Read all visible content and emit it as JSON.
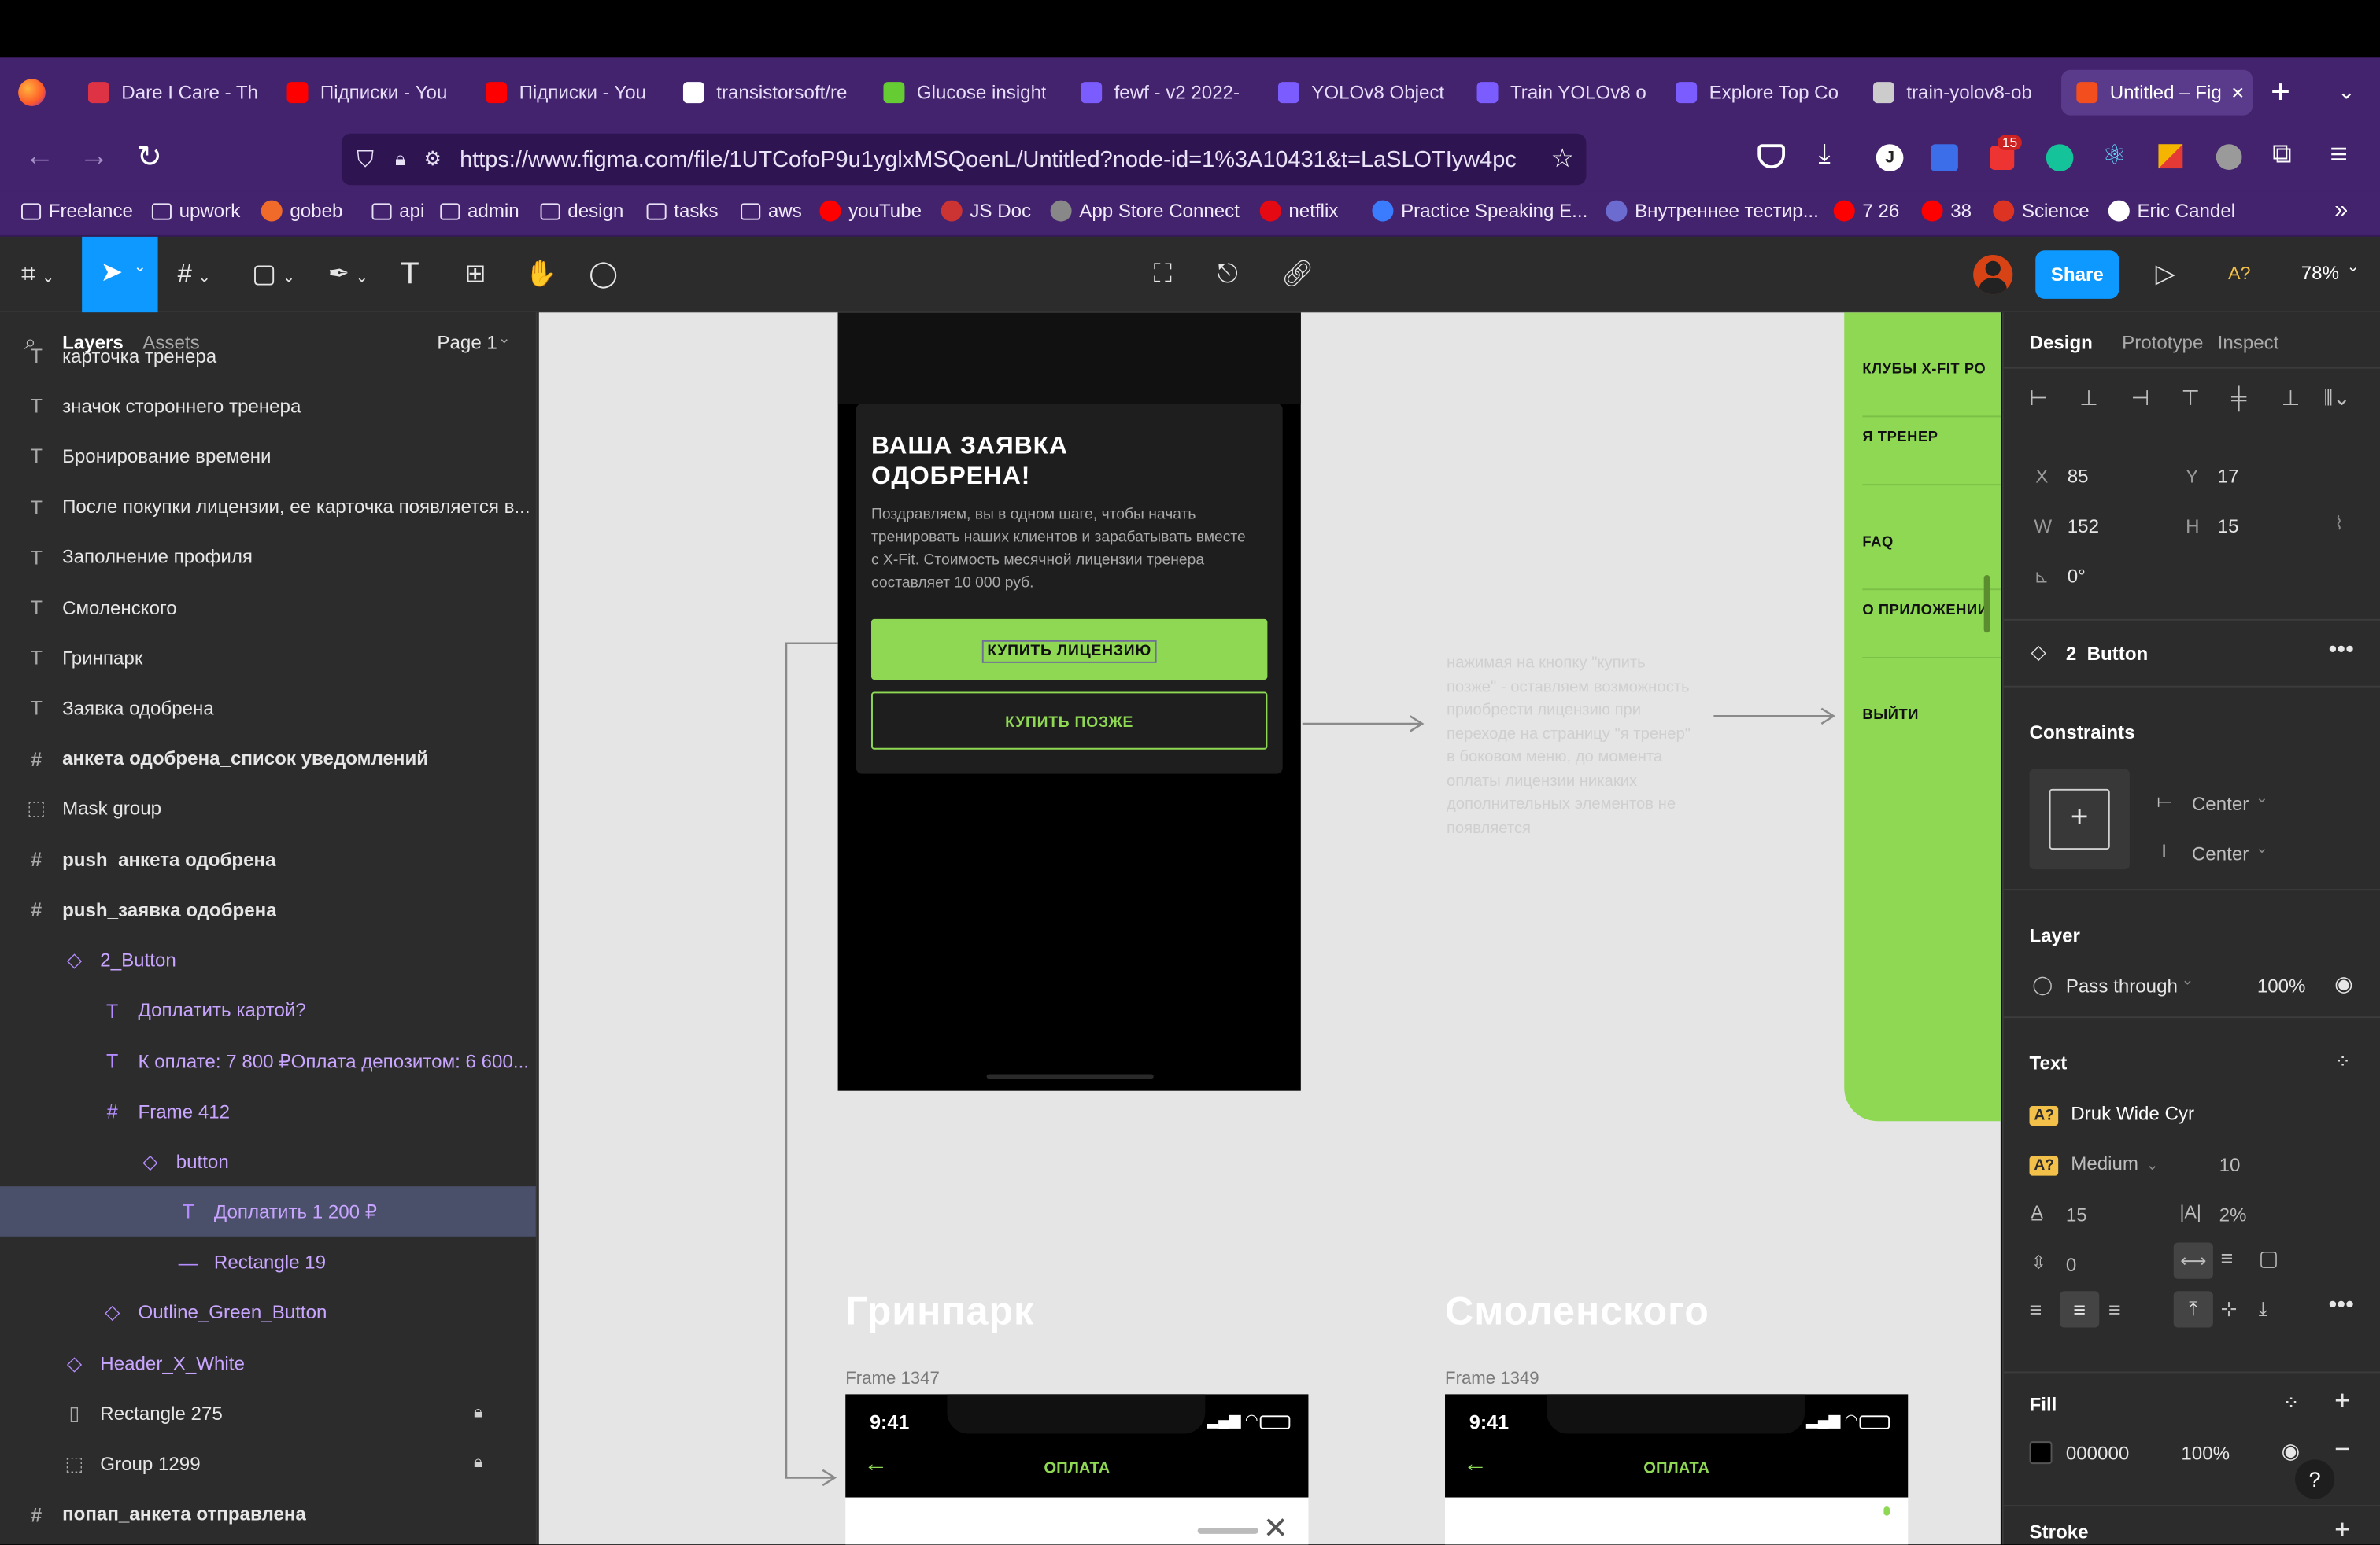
{
  "browser": {
    "tabs": [
      {
        "title": "Dare I Care - Th",
        "color": "#d34"
      },
      {
        "title": "Підписки - You",
        "color": "#f00"
      },
      {
        "title": "Підписки - You",
        "color": "#f00"
      },
      {
        "title": "transistorsoft/re",
        "color": "#fff"
      },
      {
        "title": "Glucose insight",
        "color": "#6c3"
      },
      {
        "title": "fewf - v2 2022-",
        "color": "#7b5cff"
      },
      {
        "title": "YOLOv8 Object",
        "color": "#7b5cff"
      },
      {
        "title": "Train YOLOv8 o",
        "color": "#7b5cff"
      },
      {
        "title": "Explore Top Co",
        "color": "#7b5cff"
      },
      {
        "title": "train-yolov8-ob",
        "color": "#ccc"
      },
      {
        "title": "Untitled – Fig",
        "color": "#f24e1e",
        "active": true
      }
    ],
    "url": "https://www.figma.com/file/1UTCofoP9u1yglxMSQoenL/Untitled?node-id=1%3A10431&t=LaSLOTIyw4pc",
    "ext_badge": "15",
    "bookmarks": [
      {
        "label": "Freelance",
        "kind": "folder"
      },
      {
        "label": "upwork",
        "kind": "folder"
      },
      {
        "label": "gobeb",
        "kind": "circle",
        "color": "#f06a2a"
      },
      {
        "label": "api",
        "kind": "folder"
      },
      {
        "label": "admin",
        "kind": "folder"
      },
      {
        "label": "design",
        "kind": "folder"
      },
      {
        "label": "tasks",
        "kind": "folder"
      },
      {
        "label": "aws",
        "kind": "folder"
      },
      {
        "label": "youTube",
        "kind": "circle",
        "color": "#f00"
      },
      {
        "label": "JS Doc",
        "kind": "circle",
        "color": "#c33"
      },
      {
        "label": "App Store Connect",
        "kind": "circle",
        "color": "#888"
      },
      {
        "label": "netflix",
        "kind": "circle",
        "color": "#e50914"
      },
      {
        "label": "Practice Speaking E...",
        "kind": "circle",
        "color": "#3b7cff"
      },
      {
        "label": "Внутреннее тестир...",
        "kind": "circle",
        "color": "#6b6bd0"
      },
      {
        "label": "7 26",
        "kind": "circle",
        "color": "#f00"
      },
      {
        "label": "38",
        "kind": "circle",
        "color": "#f00"
      },
      {
        "label": "Science",
        "kind": "circle",
        "color": "#d32"
      },
      {
        "label": "Eric Candel",
        "kind": "circle",
        "color": "#fff"
      }
    ]
  },
  "figma": {
    "share_label": "Share",
    "font_icon_label": "A?",
    "zoom": "78%",
    "left_tabs": {
      "layers": "Layers",
      "assets": "Assets",
      "page": "Page 1"
    },
    "layers": [
      {
        "label": "карточка тренера",
        "icon": "T",
        "indent": 0
      },
      {
        "label": "значок стороннего тренера",
        "icon": "T",
        "indent": 0
      },
      {
        "label": "Бронирование времени",
        "icon": "T",
        "indent": 0
      },
      {
        "label": "После покупки лицензии, ее карточка появляется в...",
        "icon": "T",
        "indent": 0
      },
      {
        "label": "Заполнение профиля",
        "icon": "T",
        "indent": 0
      },
      {
        "label": "Смоленского",
        "icon": "T",
        "indent": 0
      },
      {
        "label": "Гринпарк",
        "icon": "T",
        "indent": 0
      },
      {
        "label": "Заявка одобрена",
        "icon": "T",
        "indent": 0
      },
      {
        "label": "анкета одобрена_список уведомлений",
        "icon": "#",
        "indent": 0,
        "bold": true
      },
      {
        "label": "Mask group",
        "icon": "⬚",
        "indent": 0
      },
      {
        "label": "push_анкета одобрена",
        "icon": "#",
        "indent": 0,
        "bold": true
      },
      {
        "label": "push_заявка одобрена",
        "icon": "#",
        "indent": 0,
        "bold": true
      },
      {
        "label": "2_Button",
        "icon": "◇",
        "indent": 1,
        "comp": true
      },
      {
        "label": "Доплатить картой?",
        "icon": "T",
        "indent": 2,
        "comp": true
      },
      {
        "label": "К оплате: 7 800 ₽Оплата депозитом: 6 600...",
        "icon": "T",
        "indent": 2,
        "comp": true
      },
      {
        "label": "Frame 412",
        "icon": "#",
        "indent": 2,
        "comp": true
      },
      {
        "label": "button",
        "icon": "◇",
        "indent": 3,
        "comp": true
      },
      {
        "label": "Доплатить 1 200 ₽",
        "icon": "T",
        "indent": 4,
        "comp": true,
        "selected": true
      },
      {
        "label": "Rectangle 19",
        "icon": "—",
        "indent": 4,
        "comp": true
      },
      {
        "label": "Outline_Green_Button",
        "icon": "◇",
        "indent": 2,
        "comp": true
      },
      {
        "label": "Header_X_White",
        "icon": "◇",
        "indent": 1,
        "comp": true
      },
      {
        "label": "Rectangle 275",
        "icon": "▯",
        "indent": 1,
        "lock": true
      },
      {
        "label": "Group 1299",
        "icon": "⬚",
        "indent": 1,
        "lock": true
      },
      {
        "label": "попап_анкета отправлена",
        "icon": "#",
        "indent": 0,
        "bold": true
      }
    ],
    "canvas": {
      "modal_title": "ВАША ЗАЯВКА ОДОБРЕНА!",
      "modal_text": "Поздравляем, вы в одном шаге, чтобы начать тренировать наших клиентов и зарабатывать вместе с X-Fit. Стоимость месячной лицензии тренера составляет 10 000 руб.",
      "buy_button": "КУПИТЬ ЛИЦЕНЗИЮ",
      "later_button": "КУПИТЬ ПОЗЖЕ",
      "note": "нажимая на кнопку \"купить позже\" - оставляем возможность приобрести лицензию при переходе на страницу \"я тренер\" в боковом меню, до момента оплаты лицензии никаких дополнительных элементов не появляется",
      "menu_items": [
        "КЛУБЫ X-FIT РО",
        "Я ТРЕНЕР",
        "FAQ",
        "О ПРИЛОЖЕНИИ",
        "ВЫЙТИ"
      ],
      "section_left": "Гринпарк",
      "section_right": "Смоленского",
      "frame_left": "Frame 1347",
      "frame_right": "Frame 1349",
      "phone_time": "9:41",
      "pay_title": "ОПЛАТА"
    },
    "right_panel": {
      "tabs": [
        "Design",
        "Prototype",
        "Inspect"
      ],
      "x": "85",
      "y": "17",
      "w": "152",
      "h": "15",
      "rotation": "0°",
      "component": "2_Button",
      "constraints_title": "Constraints",
      "constraint_h": "Center",
      "constraint_v": "Center",
      "layer_title": "Layer",
      "blend": "Pass through",
      "opacity": "100%",
      "text_title": "Text",
      "font_family": "Druk Wide Cyr",
      "font_weight": "Medium",
      "font_size": "10",
      "line_height": "15",
      "letter_spacing": "2%",
      "paragraph_spacing": "0",
      "fill_title": "Fill",
      "fill_hex": "000000",
      "fill_opacity": "100%",
      "stroke_title": "Stroke",
      "help": "?"
    }
  }
}
